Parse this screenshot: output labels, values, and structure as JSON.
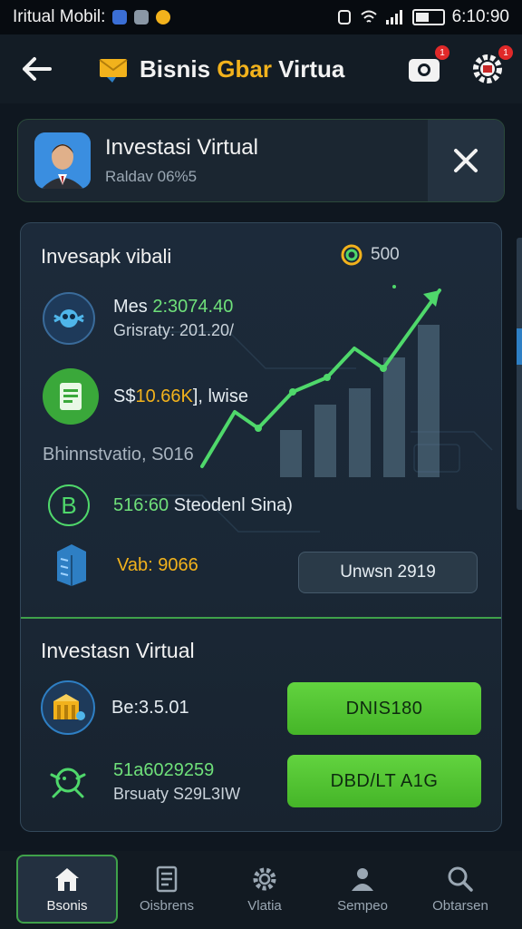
{
  "status_bar": {
    "left_text": "Iritual Mobil:",
    "time": "6:10:90"
  },
  "header": {
    "title_part1": "Bisnis ",
    "title_accent": "Gbar",
    "title_part2": " Virtua",
    "badge_camera": "1",
    "badge_settings": "1"
  },
  "profile": {
    "name": "Investasi Virtual",
    "subtitle": "Raldav 06%5"
  },
  "panel": {
    "section1_title": "Invesapk vibali",
    "section1_stat": "500",
    "row1_line1_prefix": "Mes ",
    "row1_line1_value": "2:3074.40",
    "row1_line2": "Grisraty: 201.20/",
    "row2_prefix": "S$",
    "row2_value": "10.66K",
    "row2_suffix": "], lwise",
    "muted_title": "Bhinnstvatio, S016",
    "row3_value": "516:60",
    "row3_suffix": " Steodenl Sina)",
    "row4_value": "Vab: 9066",
    "ghost_button": "Unwsn 2919",
    "section2_title": "Investasn Virtual",
    "row5_value": "Be:3.5.01",
    "button1": "DNIS180",
    "row6_line1": "51a6029259",
    "row6_line2": "Brsuaty S29L3IW",
    "button2": "DBD/LT A1G"
  },
  "nav": {
    "items": [
      {
        "label": "Bsonis",
        "icon": "home-icon"
      },
      {
        "label": "Oisbrens",
        "icon": "document-icon"
      },
      {
        "label": "Vlatia",
        "icon": "gear-icon"
      },
      {
        "label": "Sempeo",
        "icon": "person-icon"
      },
      {
        "label": "Obtarsen",
        "icon": "search-icon"
      }
    ]
  },
  "colors": {
    "accent_green": "#45b528",
    "accent_yellow": "#f2b21c",
    "background": "#0f1720"
  }
}
